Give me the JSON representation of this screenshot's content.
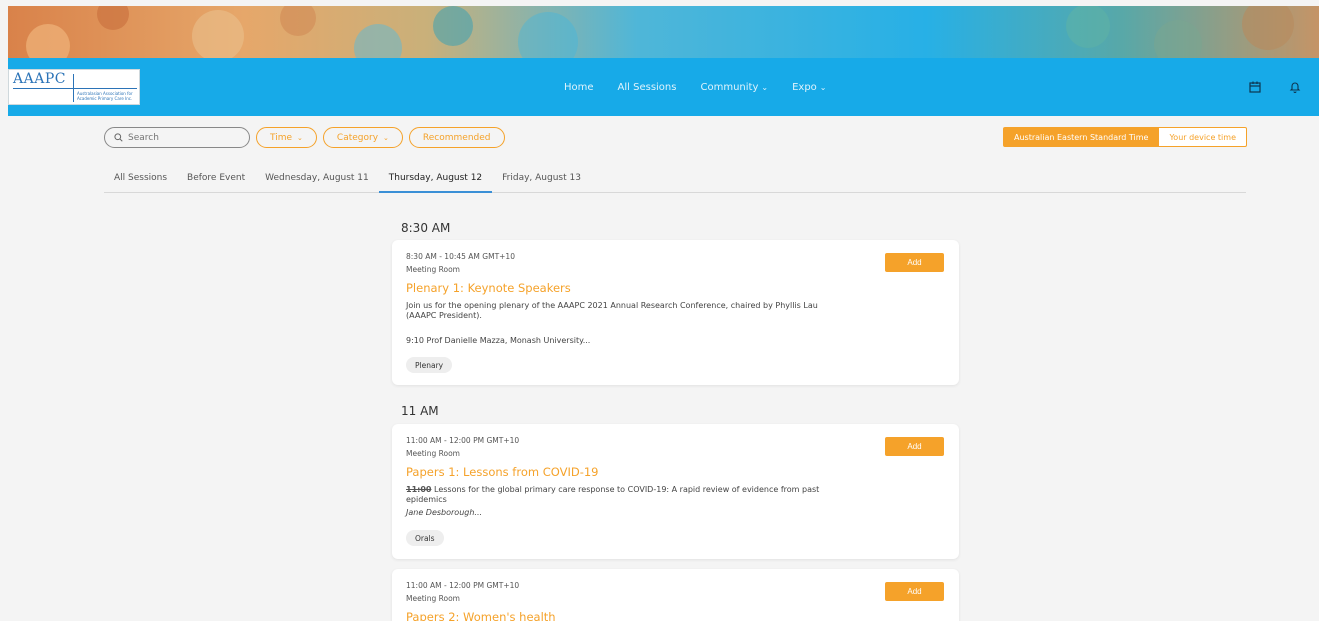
{
  "logo": {
    "title": "AAAPC",
    "subtitle": "Australasian Association for Academic Primary Care Inc."
  },
  "nav": {
    "items": [
      {
        "label": "Home"
      },
      {
        "label": "All Sessions"
      },
      {
        "label": "Community"
      },
      {
        "label": "Expo"
      }
    ],
    "icons": [
      "calendar-icon",
      "bell-icon"
    ]
  },
  "filters": {
    "search_placeholder": "Search",
    "time_label": "Time",
    "category_label": "Category",
    "recommended_label": "Recommended"
  },
  "timezone": {
    "active_label": "Australian Eastern Standard Time",
    "inactive_label": "Your device time"
  },
  "tabs": [
    {
      "label": "All Sessions"
    },
    {
      "label": "Before Event"
    },
    {
      "label": "Wednesday, August 11"
    },
    {
      "label": "Thursday, August 12",
      "active": true
    },
    {
      "label": "Friday, August 13"
    }
  ],
  "groups": [
    {
      "heading": "8:30 AM",
      "sessions": [
        {
          "time": "8:30 AM - 10:45 AM GMT+10",
          "room": "Meeting Room",
          "title": "Plenary 1: Keynote Speakers",
          "description": "Join us for the opening plenary of the AAAPC 2021 Annual Research Conference, chaired by Phyllis Lau (AAAPC President).",
          "extra": "9:10 Prof Danielle Mazza, Monash University...",
          "tag": "Plenary",
          "button": "Add"
        }
      ]
    },
    {
      "heading": "11 AM",
      "sessions": [
        {
          "time": "11:00 AM - 12:00 PM GMT+10",
          "room": "Meeting Room",
          "title": "Papers 1: Lessons from COVID-19",
          "description_time": "11:00",
          "description": "Lessons for the global primary care response to COVID-19: A rapid review of evidence from past epidemics",
          "author": "Jane Desborough...",
          "tag": "Orals",
          "button": "Add"
        },
        {
          "time": "11:00 AM - 12:00 PM GMT+10",
          "room": "Meeting Room",
          "title": "Papers 2: Women's health",
          "button": "Add"
        }
      ]
    }
  ],
  "colors": {
    "accent": "#f5a22a",
    "nav": "#17aae8",
    "tab_underline": "#3a8fd6"
  }
}
